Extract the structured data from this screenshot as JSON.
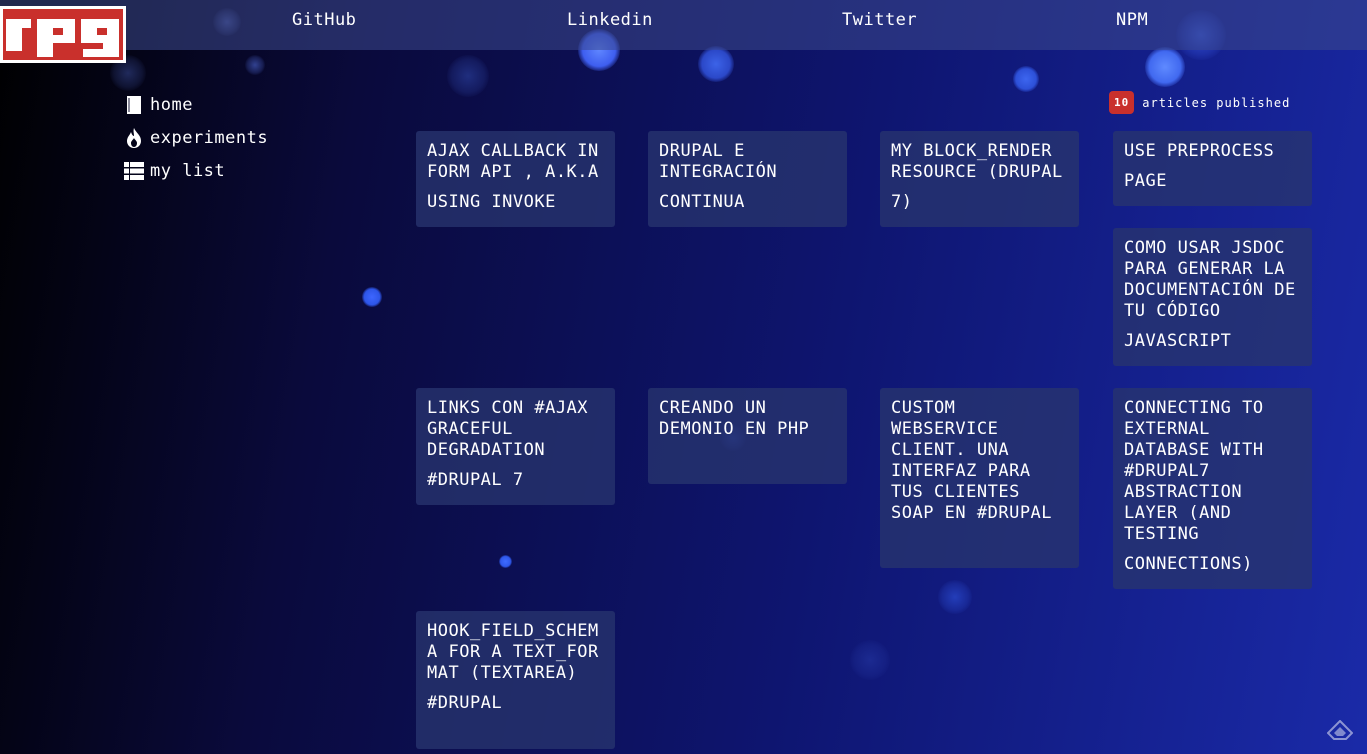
{
  "logo": {
    "text": "rpg"
  },
  "nav": {
    "github": "GitHub",
    "linkedin": "Linkedin",
    "twitter": "Twitter",
    "npm": "NPM"
  },
  "sidebar": {
    "items": [
      {
        "label": "home",
        "icon": "book-icon"
      },
      {
        "label": "experiments",
        "icon": "fire-icon"
      },
      {
        "label": "my list",
        "icon": "list-icon"
      }
    ]
  },
  "counter": {
    "count": "10",
    "label": "articles published"
  },
  "articles": [
    {
      "line1": "AJAX CALLBACK IN FORM API , A.K.A",
      "line2": "USING INVOKE"
    },
    {
      "line1": "DRUPAL E INTEGRACIÓN",
      "line2": "CONTINUA"
    },
    {
      "line1": "MY BLOCK_RENDER RESOURCE (DRUPAL",
      "line2": "7)"
    },
    {
      "line1": "USE PREPROCESS",
      "line2": "PAGE"
    },
    {
      "line1": "COMO USAR JSDOC PARA GENERAR LA DOCUMENTACIÓN DE TU CÓDIGO",
      "line2": "JAVASCRIPT"
    },
    {
      "line1": "LINKS CON #AJAX GRACEFUL DEGRADATION",
      "line2": "#DRUPAL 7"
    },
    {
      "line1": "CREANDO UN DEMONIO EN PHP",
      "line2": ""
    },
    {
      "line1": "CUSTOM WEBSERVICE CLIENT. UNA INTERFAZ PARA TUS CLIENTES SOAP EN #DRUPAL",
      "line2": ""
    },
    {
      "line1": "CONNECTING TO EXTERNAL DATABASE WITH #DRUPAL7 ABSTRACTION LAYER (AND TESTING",
      "line2": "CONNECTIONS)"
    },
    {
      "line1": "HOOK_FIELD_SCHEMA FOR A TEXT_FORMAT (TEXTAREA)",
      "line2": "#DRUPAL"
    }
  ],
  "colors": {
    "accent": "#c9302c",
    "card_bg": "#28346e"
  }
}
